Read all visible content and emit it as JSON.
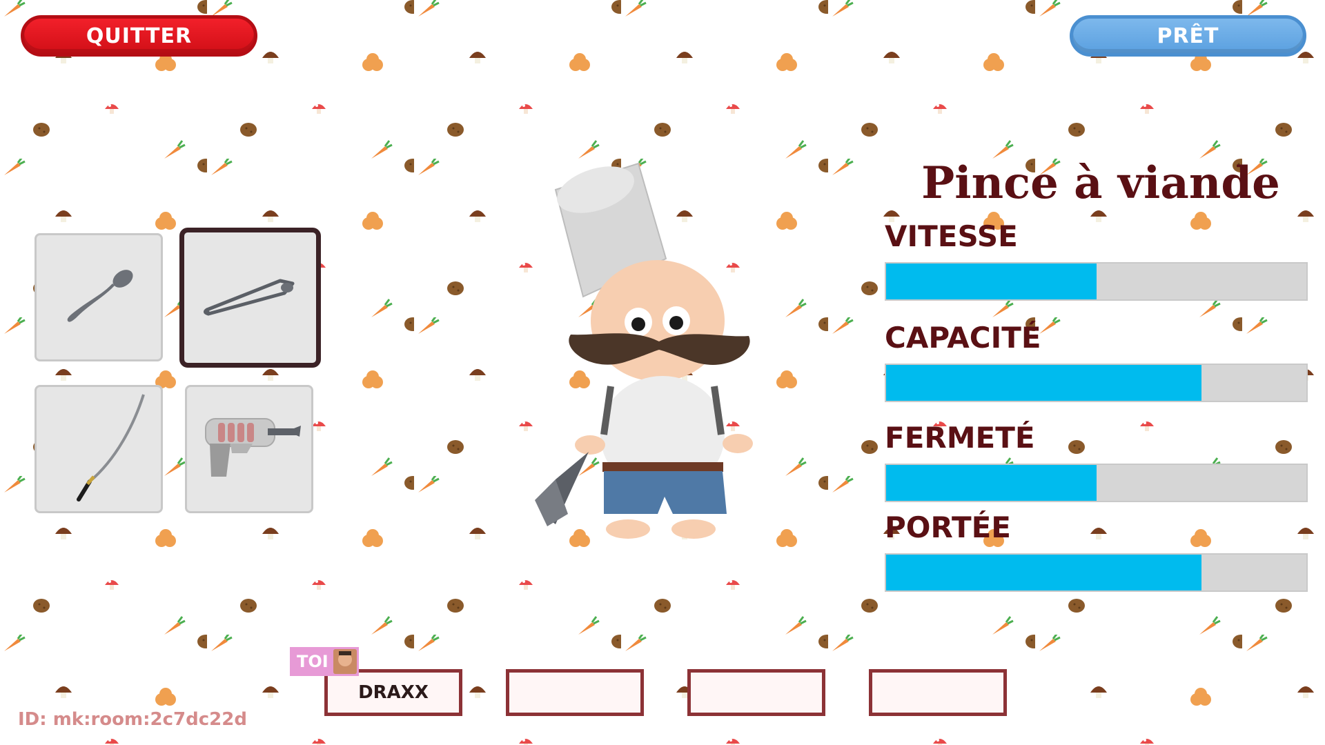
{
  "buttons": {
    "quit_label": "QUITTER",
    "ready_label": "PRÊT"
  },
  "tools": [
    {
      "name": "spoon-icon",
      "selected": false
    },
    {
      "name": "meat-tongs-icon",
      "selected": true
    },
    {
      "name": "katana-icon",
      "selected": false
    },
    {
      "name": "blaster-gun-icon",
      "selected": false
    }
  ],
  "weapon": {
    "title": "Pince à viande"
  },
  "stats": [
    {
      "label": "VITESSE",
      "value": 0.5
    },
    {
      "label": "CAPACITÉ",
      "value": 0.75
    },
    {
      "label": "FERMETÉ",
      "value": 0.5
    },
    {
      "label": "PORTÉE",
      "value": 0.75
    }
  ],
  "players": {
    "you_badge": "TOI",
    "slots": [
      "DRAXX",
      "",
      "",
      ""
    ]
  },
  "room": {
    "id_text": "ID: mk:room:2c7dc22d"
  },
  "colors": {
    "quit": "#e8141c",
    "ready": "#6aaae6",
    "stat_fill": "#00bbee",
    "title": "#5a1014"
  }
}
